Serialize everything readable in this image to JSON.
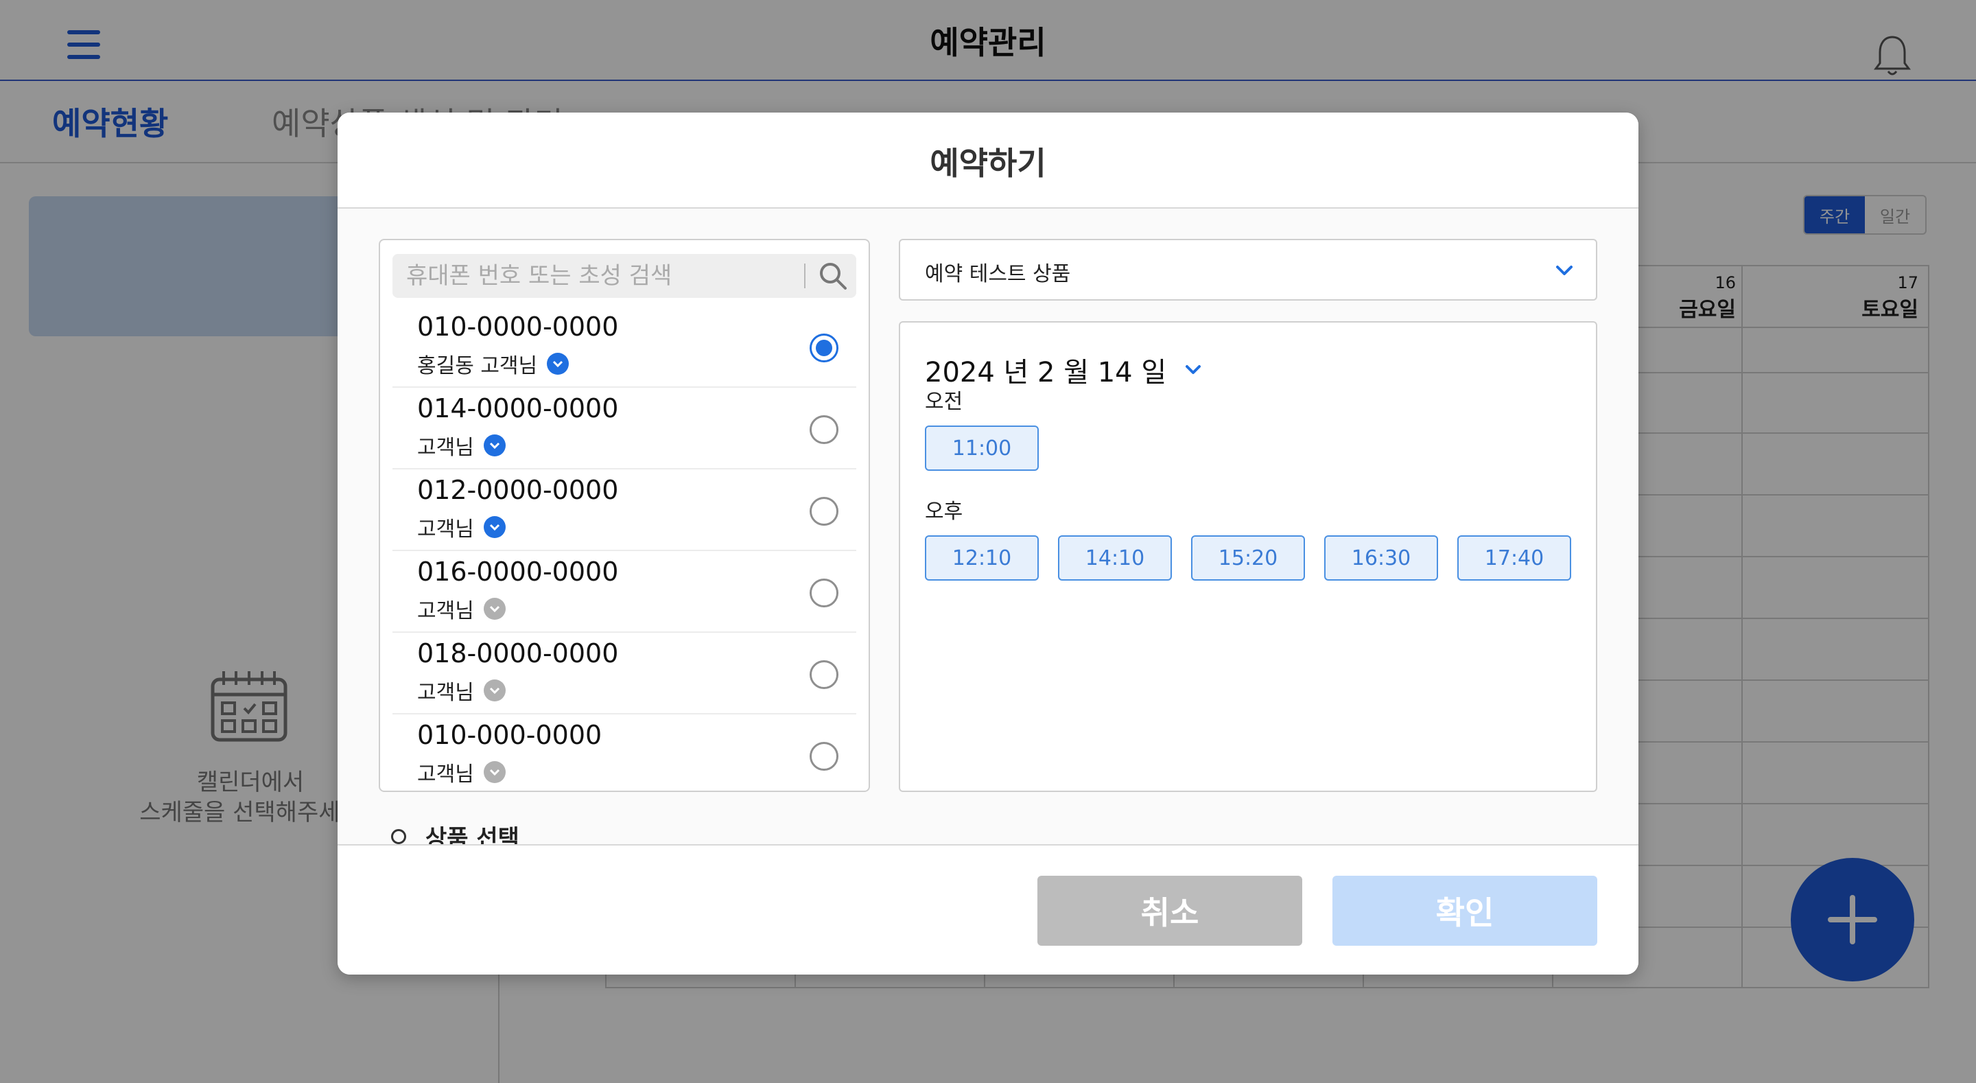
{
  "app": {
    "title": "예약관리",
    "tabs": [
      {
        "label": "예약현황",
        "active": true
      },
      {
        "label": "예약상품 생성 및 관리",
        "active": false
      }
    ],
    "empty_message_line1": "캘린더에서",
    "empty_message_line2": "스케줄을 선택해주세요",
    "view_toggle": {
      "weekly": "주간",
      "daily": "일간"
    },
    "calendar_headers": [
      {
        "day": "16",
        "weekday": "금요일"
      },
      {
        "day": "17",
        "weekday": "토요일"
      }
    ]
  },
  "modal": {
    "title": "예약하기",
    "search": {
      "placeholder": "휴대폰 번호 또는 초성 검색"
    },
    "customers": [
      {
        "phone": "010-0000-0000",
        "name": "홍길동 고객님",
        "verified": true,
        "selected": true
      },
      {
        "phone": "014-0000-0000",
        "name": "고객님",
        "verified": true,
        "selected": false
      },
      {
        "phone": "012-0000-0000",
        "name": "고객님",
        "verified": true,
        "selected": false
      },
      {
        "phone": "016-0000-0000",
        "name": "고객님",
        "verified": false,
        "selected": false
      },
      {
        "phone": "018-0000-0000",
        "name": "고객님",
        "verified": false,
        "selected": false
      },
      {
        "phone": "010-000-0000",
        "name": "고객님",
        "verified": false,
        "selected": false
      }
    ],
    "product": {
      "selected": "예약 테스트 상품"
    },
    "date": {
      "label": "2024 년 2 월 14 일"
    },
    "periods": {
      "am": {
        "label": "오전",
        "slots": [
          "11:00"
        ]
      },
      "pm": {
        "label": "오후",
        "slots": [
          "12:10",
          "14:10",
          "15:20",
          "16:30",
          "17:40"
        ]
      }
    },
    "section_label": "상품 선택",
    "buttons": {
      "cancel": "취소",
      "confirm": "확인"
    }
  },
  "colors": {
    "accent": "#1f5bd6",
    "verified": "#1f6fe0",
    "unverified": "#b0b0b0",
    "slot_border": "#4a90e2",
    "slot_bg": "#e6f0fc",
    "cancel_bg": "#bcbcbc",
    "confirm_bg": "#c2dbfa"
  }
}
